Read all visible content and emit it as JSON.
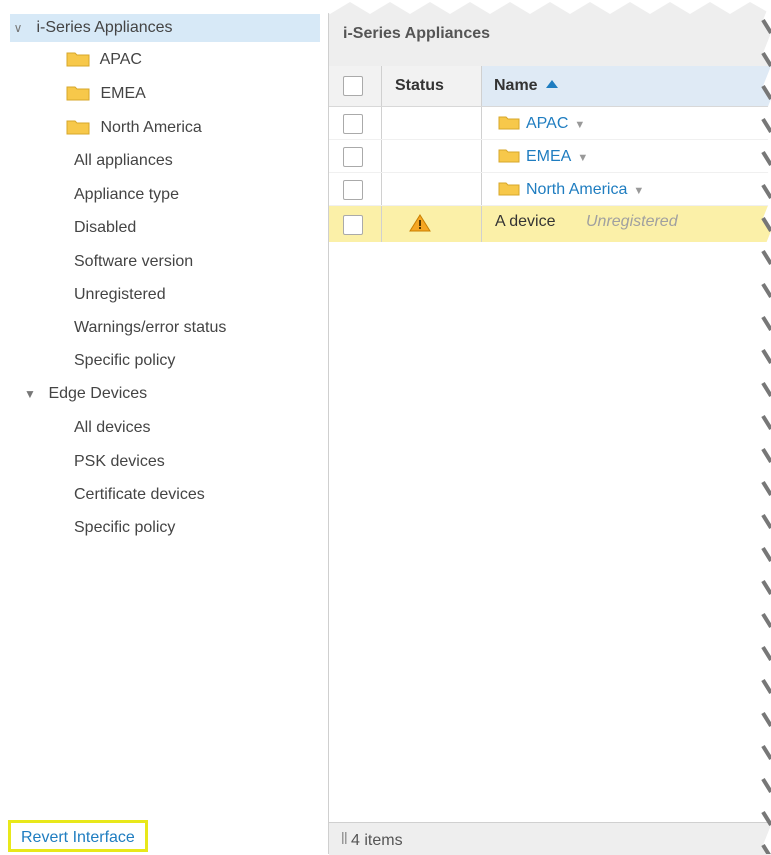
{
  "sidebar": {
    "root_label": "i-Series Appliances",
    "folders": [
      "APAC",
      "EMEA",
      "North America"
    ],
    "appliance_filters": [
      "All appliances",
      "Appliance type",
      "Disabled",
      "Software version",
      "Unregistered",
      "Warnings/error status",
      "Specific policy"
    ],
    "edge_label": "Edge Devices",
    "edge_filters": [
      "All devices",
      "PSK devices",
      "Certificate devices",
      "Specific policy"
    ],
    "revert_label": "Revert Interface"
  },
  "main": {
    "title": "i-Series Appliances",
    "columns": {
      "status": "Status",
      "name": "Name"
    },
    "rows": [
      {
        "type": "folder",
        "name": "APAC"
      },
      {
        "type": "folder",
        "name": "EMEA"
      },
      {
        "type": "folder",
        "name": "North America"
      },
      {
        "type": "device",
        "name": "A device",
        "state": "Unregistered",
        "status": "warning"
      }
    ],
    "footer": "4 items"
  },
  "colors": {
    "link": "#1f7dc0",
    "highlight": "#fbf0a8",
    "selection": "#d7e9f7",
    "revert_border": "#e8e81a"
  }
}
